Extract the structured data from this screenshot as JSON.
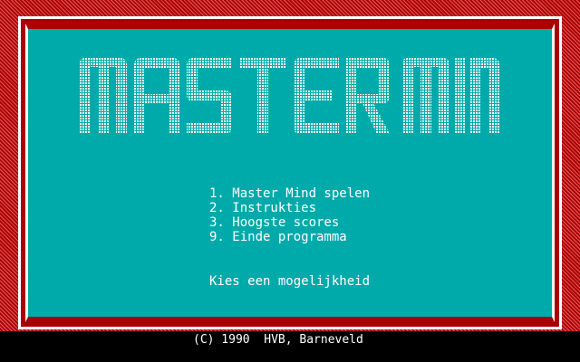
{
  "app": {
    "title": "MASTER MIND"
  },
  "menu": {
    "items": [
      {
        "label": "1. Master Mind spelen"
      },
      {
        "label": "2. Instrukties"
      },
      {
        "label": "3. Hoogste scores"
      },
      {
        "label": "9. Einde programma"
      }
    ],
    "prompt": "Kies een mogelijkheid"
  },
  "footer": {
    "copyright": "(C) 1990  HVB, Barneveld"
  },
  "colors": {
    "border": "#aa0000",
    "panel": "#00aaaa",
    "text": "#ffffff",
    "background": "#000000"
  }
}
